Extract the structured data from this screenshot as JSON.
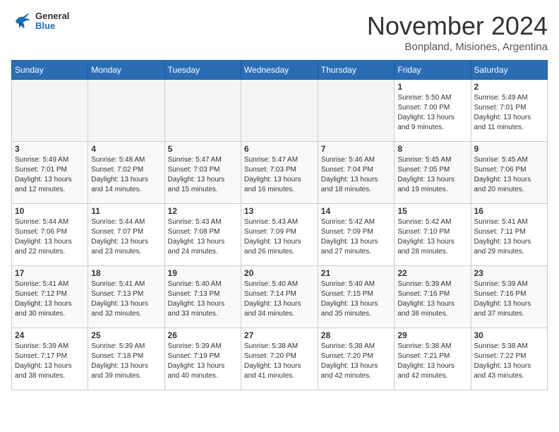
{
  "header": {
    "logo_general": "General",
    "logo_blue": "Blue",
    "month_title": "November 2024",
    "location": "Bonpland, Misiones, Argentina"
  },
  "days_of_week": [
    "Sunday",
    "Monday",
    "Tuesday",
    "Wednesday",
    "Thursday",
    "Friday",
    "Saturday"
  ],
  "weeks": [
    [
      {
        "day": "",
        "empty": true
      },
      {
        "day": "",
        "empty": true
      },
      {
        "day": "",
        "empty": true
      },
      {
        "day": "",
        "empty": true
      },
      {
        "day": "",
        "empty": true
      },
      {
        "day": "1",
        "sunrise": "5:50 AM",
        "sunset": "7:00 PM",
        "daylight": "13 hours and 9 minutes."
      },
      {
        "day": "2",
        "sunrise": "5:49 AM",
        "sunset": "7:01 PM",
        "daylight": "13 hours and 11 minutes."
      }
    ],
    [
      {
        "day": "3",
        "sunrise": "5:49 AM",
        "sunset": "7:01 PM",
        "daylight": "13 hours and 12 minutes."
      },
      {
        "day": "4",
        "sunrise": "5:48 AM",
        "sunset": "7:02 PM",
        "daylight": "13 hours and 14 minutes."
      },
      {
        "day": "5",
        "sunrise": "5:47 AM",
        "sunset": "7:03 PM",
        "daylight": "13 hours and 15 minutes."
      },
      {
        "day": "6",
        "sunrise": "5:47 AM",
        "sunset": "7:03 PM",
        "daylight": "13 hours and 16 minutes."
      },
      {
        "day": "7",
        "sunrise": "5:46 AM",
        "sunset": "7:04 PM",
        "daylight": "13 hours and 18 minutes."
      },
      {
        "day": "8",
        "sunrise": "5:45 AM",
        "sunset": "7:05 PM",
        "daylight": "13 hours and 19 minutes."
      },
      {
        "day": "9",
        "sunrise": "5:45 AM",
        "sunset": "7:06 PM",
        "daylight": "13 hours and 20 minutes."
      }
    ],
    [
      {
        "day": "10",
        "sunrise": "5:44 AM",
        "sunset": "7:06 PM",
        "daylight": "13 hours and 22 minutes."
      },
      {
        "day": "11",
        "sunrise": "5:44 AM",
        "sunset": "7:07 PM",
        "daylight": "13 hours and 23 minutes."
      },
      {
        "day": "12",
        "sunrise": "5:43 AM",
        "sunset": "7:08 PM",
        "daylight": "13 hours and 24 minutes."
      },
      {
        "day": "13",
        "sunrise": "5:43 AM",
        "sunset": "7:09 PM",
        "daylight": "13 hours and 26 minutes."
      },
      {
        "day": "14",
        "sunrise": "5:42 AM",
        "sunset": "7:09 PM",
        "daylight": "13 hours and 27 minutes."
      },
      {
        "day": "15",
        "sunrise": "5:42 AM",
        "sunset": "7:10 PM",
        "daylight": "13 hours and 28 minutes."
      },
      {
        "day": "16",
        "sunrise": "5:41 AM",
        "sunset": "7:11 PM",
        "daylight": "13 hours and 29 minutes."
      }
    ],
    [
      {
        "day": "17",
        "sunrise": "5:41 AM",
        "sunset": "7:12 PM",
        "daylight": "13 hours and 30 minutes."
      },
      {
        "day": "18",
        "sunrise": "5:41 AM",
        "sunset": "7:13 PM",
        "daylight": "13 hours and 32 minutes."
      },
      {
        "day": "19",
        "sunrise": "5:40 AM",
        "sunset": "7:13 PM",
        "daylight": "13 hours and 33 minutes."
      },
      {
        "day": "20",
        "sunrise": "5:40 AM",
        "sunset": "7:14 PM",
        "daylight": "13 hours and 34 minutes."
      },
      {
        "day": "21",
        "sunrise": "5:40 AM",
        "sunset": "7:15 PM",
        "daylight": "13 hours and 35 minutes."
      },
      {
        "day": "22",
        "sunrise": "5:39 AM",
        "sunset": "7:16 PM",
        "daylight": "13 hours and 36 minutes."
      },
      {
        "day": "23",
        "sunrise": "5:39 AM",
        "sunset": "7:16 PM",
        "daylight": "13 hours and 37 minutes."
      }
    ],
    [
      {
        "day": "24",
        "sunrise": "5:39 AM",
        "sunset": "7:17 PM",
        "daylight": "13 hours and 38 minutes."
      },
      {
        "day": "25",
        "sunrise": "5:39 AM",
        "sunset": "7:18 PM",
        "daylight": "13 hours and 39 minutes."
      },
      {
        "day": "26",
        "sunrise": "5:39 AM",
        "sunset": "7:19 PM",
        "daylight": "13 hours and 40 minutes."
      },
      {
        "day": "27",
        "sunrise": "5:38 AM",
        "sunset": "7:20 PM",
        "daylight": "13 hours and 41 minutes."
      },
      {
        "day": "28",
        "sunrise": "5:38 AM",
        "sunset": "7:20 PM",
        "daylight": "13 hours and 42 minutes."
      },
      {
        "day": "29",
        "sunrise": "5:38 AM",
        "sunset": "7:21 PM",
        "daylight": "13 hours and 42 minutes."
      },
      {
        "day": "30",
        "sunrise": "5:38 AM",
        "sunset": "7:22 PM",
        "daylight": "13 hours and 43 minutes."
      }
    ]
  ]
}
